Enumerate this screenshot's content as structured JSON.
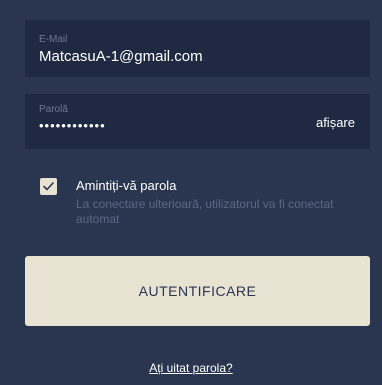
{
  "email_field": {
    "label": "E-Mail",
    "value": "MatcasuA-1@gmail.com"
  },
  "password_field": {
    "label": "Parolă",
    "masked_value": "••••••••••••",
    "show_label": "afișare"
  },
  "remember": {
    "checked": true,
    "title": "Amintiți-vă parola",
    "description": "La conectare ulterioară, utilizatorul va fi conectat automat"
  },
  "login_button": {
    "label": "AUTENTIFICARE"
  },
  "forgot_link": {
    "label": "Ați uitat parola?"
  },
  "colors": {
    "background": "#2a3650",
    "field_bg": "#1f2a42",
    "button_bg": "#e9e3d4",
    "muted_text": "#5b6883"
  }
}
